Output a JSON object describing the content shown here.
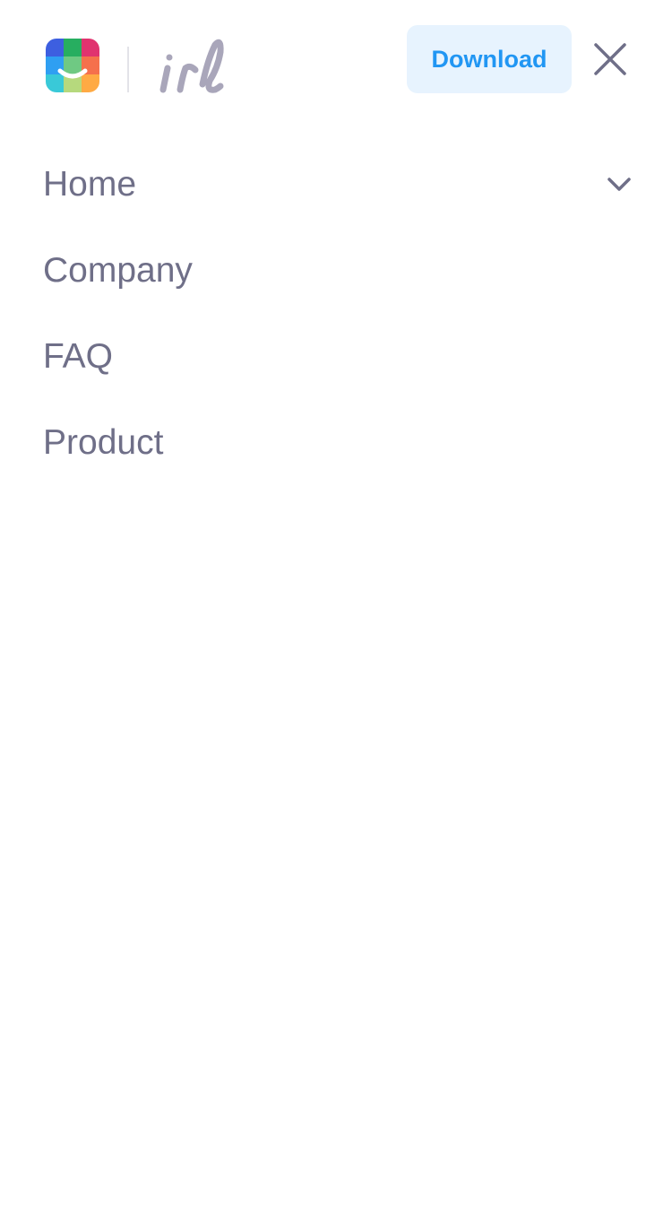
{
  "header": {
    "logo_icon": "app-logo-icon",
    "wordmark": "irl",
    "download_label": "Download",
    "close_icon": "close-icon"
  },
  "nav": {
    "items": [
      {
        "label": "Home",
        "icon": "chevron-down-icon"
      },
      {
        "label": "Company"
      },
      {
        "label": "FAQ"
      },
      {
        "label": "Product"
      }
    ]
  },
  "colors": {
    "accent": "#2196f3",
    "accent_bg": "#e7f3fe",
    "nav_text": "#6f6f88",
    "wordmark": "#a9a6ba",
    "divider": "#e3e3e8"
  }
}
